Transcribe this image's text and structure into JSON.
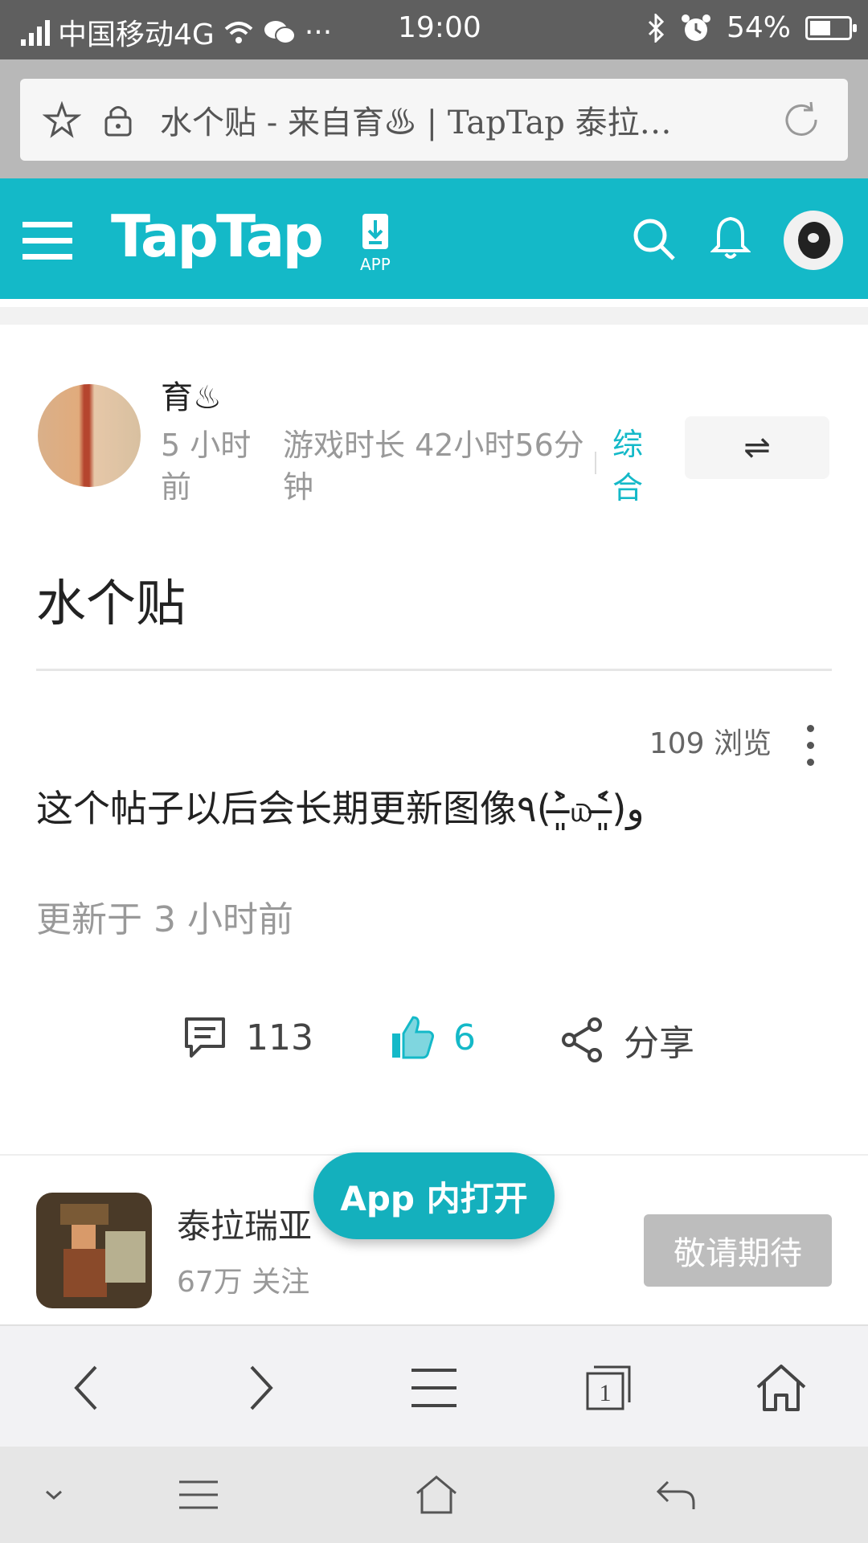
{
  "status": {
    "carrier": "中国移动4G",
    "extra": "···",
    "time": "19:00",
    "battery": "54%",
    "battery_level": 0.54
  },
  "browser": {
    "url_title": "水个贴 - 来自育♨ | TapTap 泰拉…"
  },
  "header": {
    "logo": "TapTap",
    "app_label": "APP"
  },
  "post": {
    "author": "育♨",
    "time": "5 小时前",
    "playtime": "游戏时长 42小时56分钟",
    "category": "综合",
    "switch_label": "⇌",
    "title": "水个贴",
    "views": "109 浏览",
    "body": "这个帖子以后会长期更新图像٩(˃̶͈̀௰˂̶͈́)و",
    "updated": "更新于 3 小时前"
  },
  "actions": {
    "comments": "113",
    "likes": "6",
    "share": "分享"
  },
  "game": {
    "name": "泰拉瑞亚",
    "follows": "67万 关注",
    "button": "敬请期待"
  },
  "open_app": "App 内打开",
  "browser_nav": {
    "tabs_count": "1"
  }
}
